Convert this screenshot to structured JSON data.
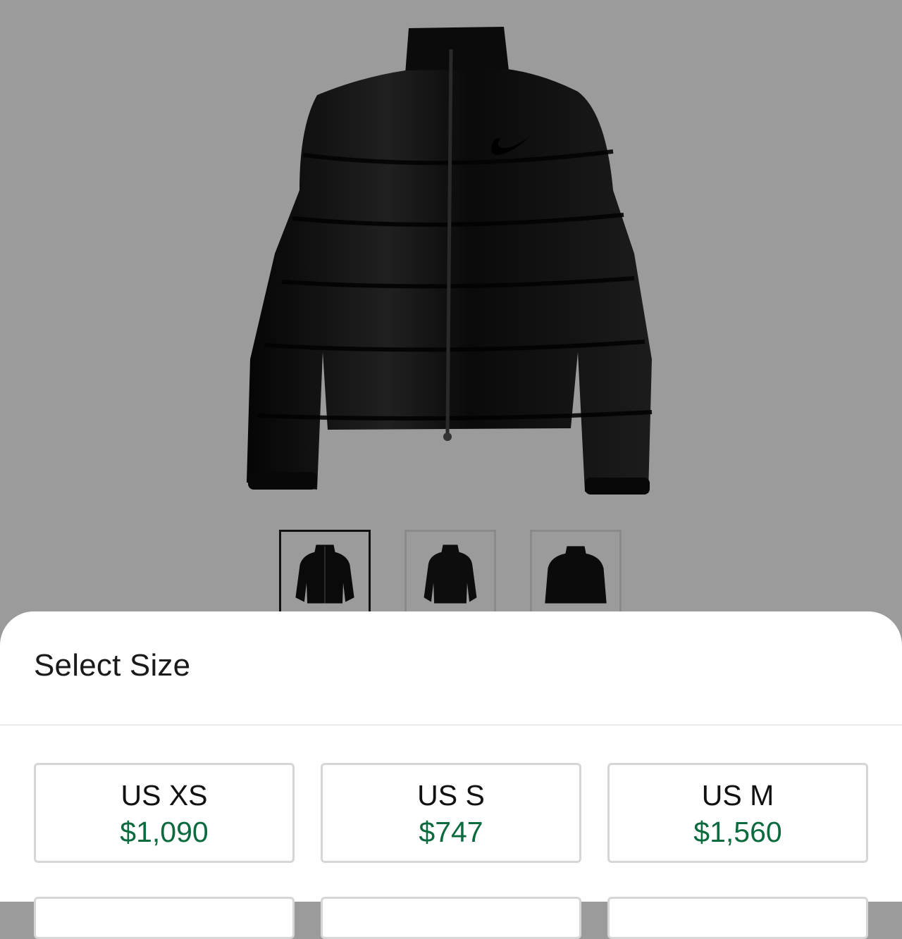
{
  "product": {
    "image_alt": "Black puffer jacket",
    "thumbnails": [
      {
        "name": "front",
        "active": true
      },
      {
        "name": "back",
        "active": false
      },
      {
        "name": "detail",
        "active": false
      }
    ]
  },
  "size_sheet": {
    "title": "Select Size",
    "sizes": [
      {
        "label": "US XS",
        "price": "$1,090"
      },
      {
        "label": "US S",
        "price": "$747"
      },
      {
        "label": "US M",
        "price": "$1,560"
      }
    ]
  },
  "colors": {
    "background": "#9b9b9b",
    "price": "#0b6b3f",
    "card_border": "#d6d6d6"
  }
}
